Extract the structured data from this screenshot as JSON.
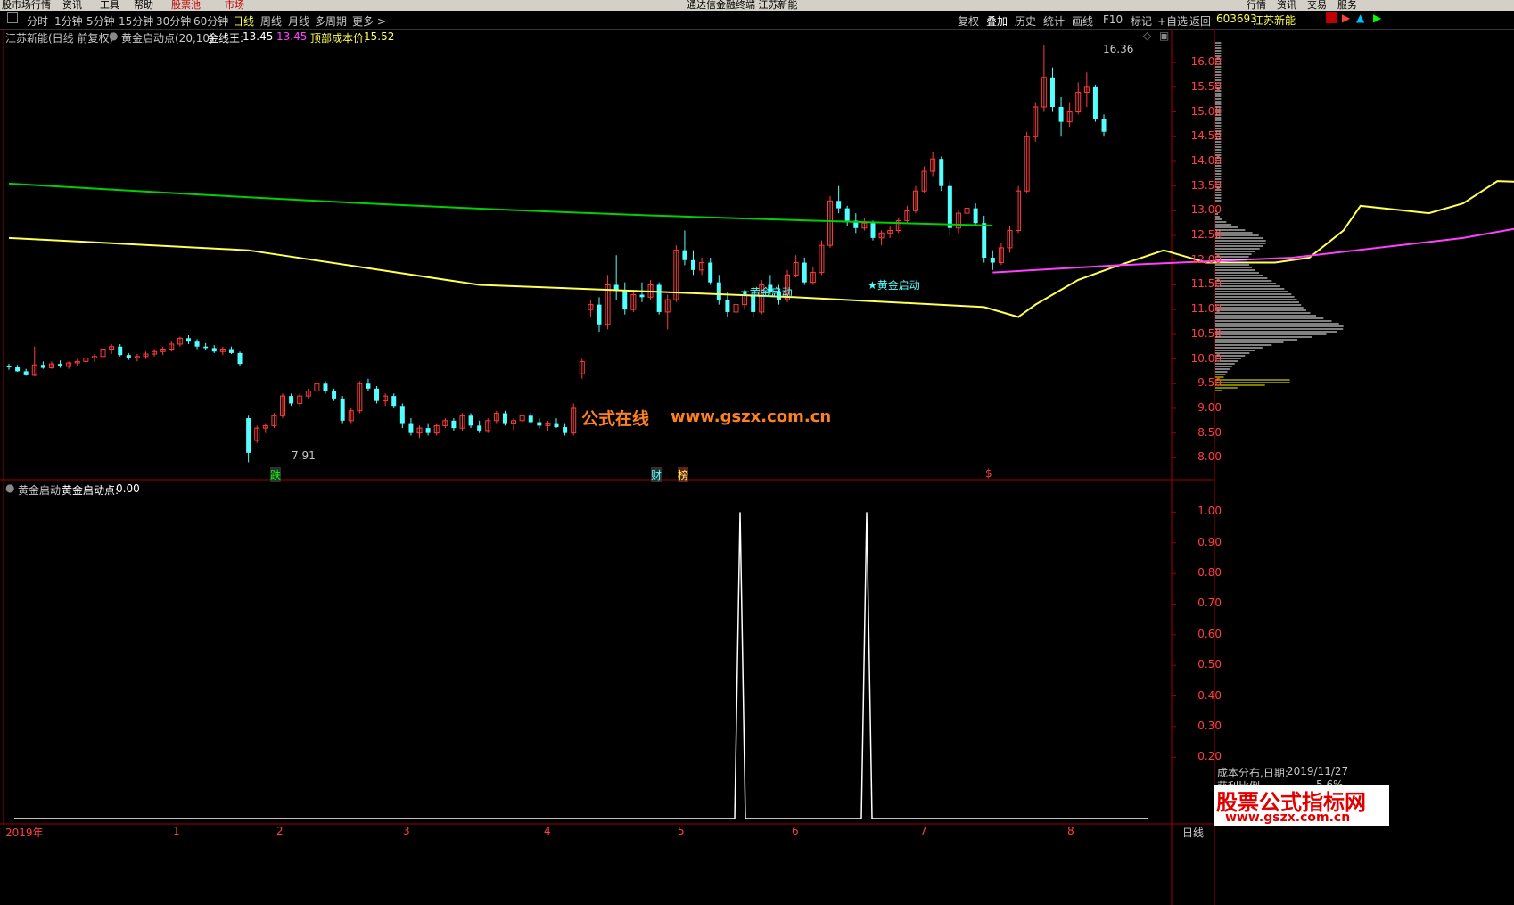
{
  "menu": {
    "items": [
      "股市场行情",
      "资讯",
      "工具",
      "帮助",
      "股票池",
      "市场"
    ],
    "title": "通达信金融终端 江苏新能",
    "right_items": [
      "行情",
      "资讯",
      "交易",
      "服务"
    ]
  },
  "toolbar": {
    "periods": [
      "分时",
      "1分钟",
      "5分钟",
      "15分钟",
      "30分钟",
      "60分钟",
      "日线",
      "周线",
      "月线",
      "多周期",
      "更多 >"
    ],
    "active_period": "日线",
    "right_buttons": [
      "复权",
      "叠加",
      "历史",
      "统计",
      "画线",
      "F10",
      "标记",
      "+自选",
      "返回"
    ],
    "stock_code": "603693",
    "stock_name": "江苏新能"
  },
  "main_panel": {
    "stock_title": "江苏新能(日线 前复权)",
    "indicator_name": "黄金启动点(20,10)",
    "jxw_label": "金线王:",
    "jxw_value": "13.45",
    "jxw_value2": "13.45",
    "top_cost_label": "顶部成本价:",
    "top_cost_value": "15.52",
    "high_label": "16.36",
    "low_label": "7.91",
    "signal_label": "★黄金启动",
    "markers": [
      "跌",
      "财",
      "榜",
      "$"
    ],
    "y_ticks": [
      "16.00",
      "15.50",
      "15.00",
      "14.50",
      "14.00",
      "13.50",
      "13.00",
      "12.50",
      "12.00",
      "11.50",
      "11.00",
      "10.50",
      "10.00",
      "9.50",
      "9.00",
      "8.50",
      "8.00"
    ]
  },
  "sub_panel": {
    "title": "黄金启动",
    "value_label": "黄金启动点:",
    "value": "0.00",
    "y_ticks": [
      "1.00",
      "0.90",
      "0.80",
      "0.70",
      "0.60",
      "0.50",
      "0.40",
      "0.30",
      "0.20"
    ]
  },
  "x_axis": {
    "labels": [
      "2019年",
      "1",
      "2",
      "3",
      "4",
      "5",
      "6",
      "7",
      "8"
    ],
    "period_label": "日线"
  },
  "cost_dist": {
    "title": "成本分布,日期:",
    "date": "2019/11/27",
    "profit_label": "获利比例",
    "profit_value": "5.6%"
  },
  "watermarks": {
    "center": "公式在线",
    "center_url": "www.gszx.com.cn",
    "corner": "股票公式指标网",
    "corner_url": "www.gszx.com.cn"
  },
  "chart_data": {
    "type": "candlestick",
    "ylim": [
      7.7,
      16.4
    ],
    "colors": {
      "up": "#ff3c3c",
      "down": "#54ffff",
      "ma_green": "#00d000",
      "ma_yellow": "#ffff54",
      "ma_magenta": "#ff40ff"
    },
    "candles": [
      [
        9.86,
        9.9,
        9.78,
        9.83
      ],
      [
        9.83,
        9.88,
        9.74,
        9.75
      ],
      [
        9.75,
        9.8,
        9.66,
        9.67
      ],
      [
        9.67,
        10.25,
        9.65,
        9.88
      ],
      [
        9.88,
        9.95,
        9.8,
        9.82
      ],
      [
        9.82,
        9.95,
        9.8,
        9.9
      ],
      [
        9.9,
        9.97,
        9.82,
        9.85
      ],
      [
        9.85,
        9.95,
        9.8,
        9.92
      ],
      [
        9.92,
        10.0,
        9.85,
        9.95
      ],
      [
        9.95,
        10.05,
        9.9,
        10.02
      ],
      [
        10.02,
        10.1,
        9.95,
        10.05
      ],
      [
        10.05,
        10.25,
        10.0,
        10.2
      ],
      [
        10.2,
        10.3,
        10.1,
        10.25
      ],
      [
        10.25,
        10.3,
        10.05,
        10.08
      ],
      [
        10.08,
        10.12,
        9.98,
        10.02
      ],
      [
        10.02,
        10.1,
        9.95,
        10.05
      ],
      [
        10.05,
        10.15,
        10.0,
        10.1
      ],
      [
        10.1,
        10.2,
        10.05,
        10.15
      ],
      [
        10.15,
        10.25,
        10.08,
        10.2
      ],
      [
        10.2,
        10.35,
        10.15,
        10.3
      ],
      [
        10.3,
        10.45,
        10.25,
        10.42
      ],
      [
        10.42,
        10.48,
        10.3,
        10.35
      ],
      [
        10.35,
        10.4,
        10.2,
        10.25
      ],
      [
        10.25,
        10.32,
        10.18,
        10.22
      ],
      [
        10.22,
        10.28,
        10.12,
        10.15
      ],
      [
        10.15,
        10.25,
        10.08,
        10.2
      ],
      [
        10.2,
        10.25,
        10.1,
        10.12
      ],
      [
        10.12,
        10.15,
        9.85,
        9.9
      ],
      [
        8.8,
        8.85,
        7.91,
        8.1
      ],
      [
        8.35,
        8.65,
        8.3,
        8.6
      ],
      [
        8.6,
        8.7,
        8.5,
        8.65
      ],
      [
        8.65,
        8.9,
        8.6,
        8.85
      ],
      [
        8.85,
        9.3,
        8.8,
        9.25
      ],
      [
        9.25,
        9.3,
        9.05,
        9.1
      ],
      [
        9.1,
        9.3,
        9.05,
        9.25
      ],
      [
        9.25,
        9.4,
        9.2,
        9.35
      ],
      [
        9.35,
        9.55,
        9.3,
        9.5
      ],
      [
        9.5,
        9.55,
        9.3,
        9.35
      ],
      [
        9.35,
        9.4,
        9.15,
        9.2
      ],
      [
        9.2,
        9.25,
        8.7,
        8.75
      ],
      [
        8.75,
        9.0,
        8.7,
        8.95
      ],
      [
        8.95,
        9.55,
        8.9,
        9.5
      ],
      [
        9.5,
        9.6,
        9.35,
        9.4
      ],
      [
        9.4,
        9.45,
        9.1,
        9.15
      ],
      [
        9.15,
        9.3,
        9.05,
        9.25
      ],
      [
        9.25,
        9.3,
        9.0,
        9.05
      ],
      [
        9.05,
        9.1,
        8.6,
        8.7
      ],
      [
        8.7,
        8.8,
        8.45,
        8.5
      ],
      [
        8.5,
        8.65,
        8.4,
        8.6
      ],
      [
        8.6,
        8.7,
        8.45,
        8.5
      ],
      [
        8.5,
        8.7,
        8.45,
        8.65
      ],
      [
        8.65,
        8.8,
        8.6,
        8.75
      ],
      [
        8.75,
        8.8,
        8.55,
        8.6
      ],
      [
        8.6,
        8.9,
        8.55,
        8.85
      ],
      [
        8.85,
        8.9,
        8.6,
        8.65
      ],
      [
        8.65,
        8.75,
        8.5,
        8.55
      ],
      [
        8.55,
        8.8,
        8.5,
        8.75
      ],
      [
        8.75,
        8.95,
        8.7,
        8.9
      ],
      [
        8.9,
        8.95,
        8.65,
        8.7
      ],
      [
        8.7,
        8.8,
        8.55,
        8.75
      ],
      [
        8.75,
        8.9,
        8.7,
        8.85
      ],
      [
        8.85,
        8.9,
        8.7,
        8.72
      ],
      [
        8.72,
        8.8,
        8.6,
        8.65
      ],
      [
        8.65,
        8.75,
        8.55,
        8.7
      ],
      [
        8.7,
        8.8,
        8.6,
        8.62
      ],
      [
        8.62,
        8.7,
        8.45,
        8.5
      ],
      [
        8.5,
        9.1,
        8.45,
        9.0
      ],
      [
        9.7,
        10.0,
        9.6,
        9.95
      ],
      [
        11.0,
        11.2,
        10.85,
        11.1
      ],
      [
        11.1,
        11.25,
        10.55,
        10.7
      ],
      [
        10.7,
        11.7,
        10.6,
        11.5
      ],
      [
        11.5,
        12.1,
        11.2,
        11.4
      ],
      [
        11.4,
        11.55,
        10.9,
        11.0
      ],
      [
        11.0,
        11.4,
        10.95,
        11.3
      ],
      [
        11.3,
        11.55,
        11.15,
        11.25
      ],
      [
        11.25,
        11.6,
        11.2,
        11.5
      ],
      [
        11.5,
        11.55,
        10.9,
        10.95
      ],
      [
        10.95,
        11.3,
        10.6,
        11.2
      ],
      [
        11.2,
        12.3,
        11.15,
        12.2
      ],
      [
        12.2,
        12.6,
        11.9,
        12.0
      ],
      [
        12.0,
        12.2,
        11.7,
        11.8
      ],
      [
        11.8,
        12.05,
        11.7,
        11.95
      ],
      [
        11.95,
        12.05,
        11.5,
        11.55
      ],
      [
        11.55,
        11.7,
        11.1,
        11.2
      ],
      [
        11.2,
        11.35,
        10.85,
        10.95
      ],
      [
        10.95,
        11.2,
        10.9,
        11.1
      ],
      [
        11.1,
        11.4,
        11.0,
        11.3
      ],
      [
        11.3,
        11.4,
        10.85,
        10.95
      ],
      [
        10.95,
        11.6,
        10.9,
        11.5
      ],
      [
        11.5,
        11.7,
        11.3,
        11.35
      ],
      [
        11.35,
        11.5,
        11.1,
        11.2
      ],
      [
        11.2,
        11.8,
        11.15,
        11.7
      ],
      [
        11.7,
        12.1,
        11.65,
        11.95
      ],
      [
        11.95,
        12.05,
        11.5,
        11.55
      ],
      [
        11.55,
        11.85,
        11.5,
        11.75
      ],
      [
        11.75,
        12.4,
        11.7,
        12.3
      ],
      [
        12.3,
        13.3,
        12.25,
        13.2
      ],
      [
        13.2,
        13.5,
        12.95,
        13.05
      ],
      [
        13.05,
        13.1,
        12.7,
        12.8
      ],
      [
        12.8,
        12.95,
        12.55,
        12.65
      ],
      [
        12.65,
        12.85,
        12.6,
        12.75
      ],
      [
        12.75,
        12.8,
        12.4,
        12.45
      ],
      [
        12.45,
        12.6,
        12.3,
        12.55
      ],
      [
        12.55,
        12.7,
        12.45,
        12.6
      ],
      [
        12.6,
        12.85,
        12.55,
        12.8
      ],
      [
        12.8,
        13.1,
        12.75,
        13.0
      ],
      [
        13.0,
        13.5,
        12.95,
        13.4
      ],
      [
        13.4,
        13.9,
        13.35,
        13.8
      ],
      [
        13.8,
        14.2,
        13.7,
        14.05
      ],
      [
        14.05,
        14.1,
        13.4,
        13.5
      ],
      [
        13.5,
        13.6,
        12.5,
        12.65
      ],
      [
        12.65,
        13.0,
        12.55,
        12.95
      ],
      [
        12.95,
        13.2,
        12.8,
        13.05
      ],
      [
        13.05,
        13.15,
        12.7,
        12.75
      ],
      [
        12.75,
        12.9,
        11.95,
        12.05
      ],
      [
        12.05,
        12.2,
        11.8,
        11.95
      ],
      [
        11.95,
        12.35,
        11.9,
        12.25
      ],
      [
        12.25,
        12.7,
        12.15,
        12.6
      ],
      [
        12.6,
        13.5,
        12.55,
        13.4
      ],
      [
        13.4,
        14.6,
        13.35,
        14.5
      ],
      [
        14.5,
        15.2,
        14.4,
        15.1
      ],
      [
        15.1,
        16.36,
        15.0,
        15.7
      ],
      [
        15.7,
        15.9,
        15.0,
        15.1
      ],
      [
        15.1,
        15.3,
        14.5,
        14.8
      ],
      [
        14.8,
        15.2,
        14.7,
        15.0
      ],
      [
        15.0,
        15.6,
        14.95,
        15.4
      ],
      [
        15.4,
        15.8,
        15.1,
        15.5
      ],
      [
        15.5,
        15.55,
        14.8,
        14.85
      ],
      [
        14.85,
        14.95,
        14.5,
        14.6
      ]
    ],
    "ma_green": [
      13.55,
      12.7
    ],
    "ma_yellow": [
      [
        0,
        12.45
      ],
      [
        28,
        12.2
      ],
      [
        55,
        11.5
      ],
      [
        92,
        11.25
      ],
      [
        114,
        11.05
      ],
      [
        118,
        10.85
      ],
      [
        120,
        11.1
      ],
      [
        125,
        11.6
      ],
      [
        129,
        11.85
      ],
      [
        135,
        12.2
      ],
      [
        140,
        11.95
      ],
      [
        148,
        11.95
      ],
      [
        152,
        12.05
      ],
      [
        156,
        12.6
      ],
      [
        158,
        13.1
      ],
      [
        166,
        12.95
      ],
      [
        170,
        13.15
      ],
      [
        174,
        13.6
      ],
      [
        183,
        13.55
      ],
      [
        186,
        13.8
      ],
      [
        188,
        15.0
      ],
      [
        190,
        15.4
      ],
      [
        195,
        15.5
      ],
      [
        200,
        15.55
      ]
    ],
    "ma_magenta": [
      [
        115,
        11.75
      ],
      [
        130,
        11.9
      ],
      [
        150,
        12.05
      ],
      [
        170,
        12.45
      ],
      [
        183,
        12.85
      ],
      [
        186,
        12.95
      ],
      [
        200,
        13.5
      ]
    ],
    "golden_start": [
      0,
      0,
      0,
      0,
      0,
      0,
      0,
      0,
      1,
      0,
      0,
      0,
      0,
      0,
      0,
      0,
      0,
      0,
      0,
      0,
      1,
      0,
      0,
      0
    ],
    "sub_ylim": [
      0,
      1.1
    ]
  }
}
